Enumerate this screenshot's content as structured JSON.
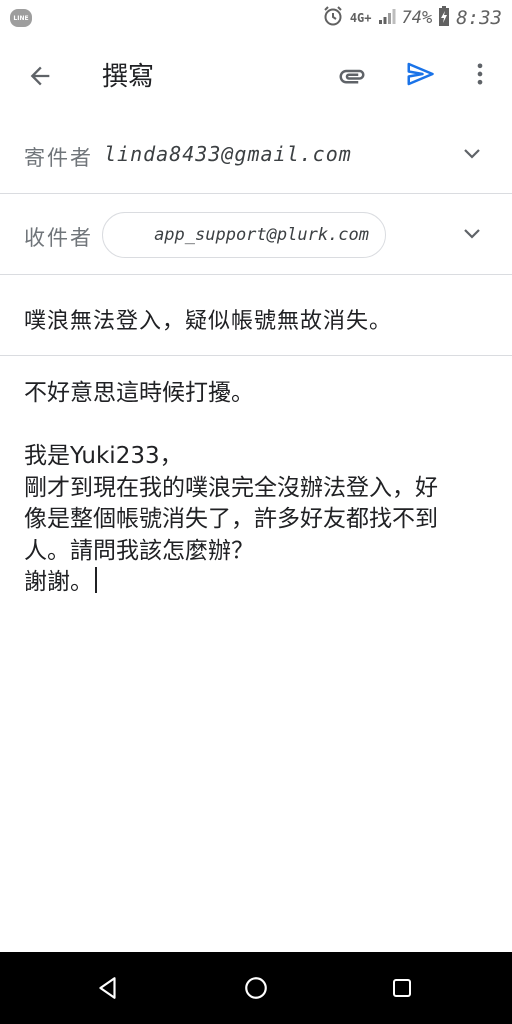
{
  "status_bar": {
    "app_icon_text": "LINE",
    "network": "4G+",
    "battery": "74%",
    "time": "8:33"
  },
  "app_bar": {
    "title": "撰寫"
  },
  "compose": {
    "from_label": "寄件者",
    "from_value": "linda8433@gmail.com",
    "to_label": "收件者",
    "to_chip": "app_support@plurk.com",
    "subject": "噗浪無法登入，疑似帳號無故消失。",
    "body_lines": [
      "不好意思這時候打擾。",
      "",
      "我是Yuki233，",
      "剛才到現在我的噗浪完全沒辦法登入，好",
      "像是整個帳號消失了，許多好友都找不到",
      "人。請問我該怎麼辦？",
      "謝謝。"
    ]
  },
  "colors": {
    "accent": "#1a73e8",
    "text": "#202124",
    "secondary": "#70757a",
    "divider": "#dadce0",
    "nav_bar": "#000000"
  },
  "icons": {
    "back": "arrow-left-icon",
    "attach": "paperclip-icon",
    "send": "send-icon",
    "more": "more-vert-icon",
    "expand": "chevron-down-icon"
  }
}
